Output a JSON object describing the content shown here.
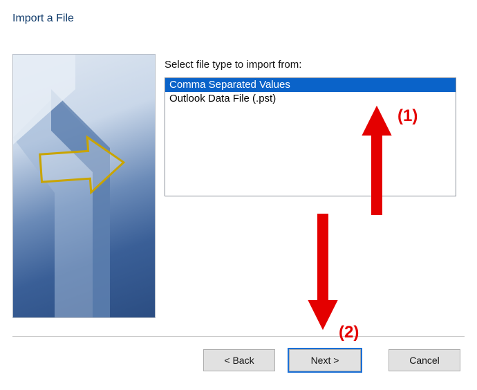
{
  "title": "Import a File",
  "list_label": "Select file type to import from:",
  "file_types": {
    "options": [
      {
        "label": "Comma Separated Values",
        "selected": true
      },
      {
        "label": "Outlook Data File (.pst)",
        "selected": false
      }
    ]
  },
  "buttons": {
    "back": "< Back",
    "next": "Next >",
    "cancel": "Cancel"
  },
  "annotations": {
    "one": "(1)",
    "two": "(2)"
  }
}
